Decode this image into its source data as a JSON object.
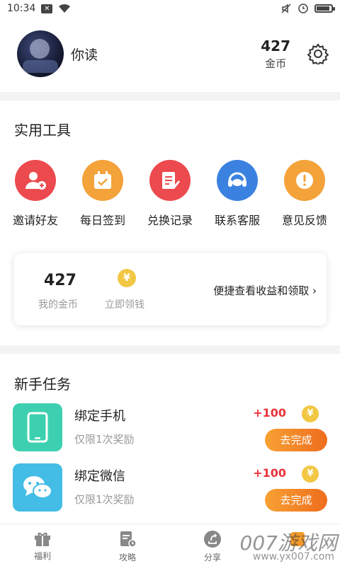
{
  "status_bar": {
    "time": "10:34",
    "x_badge": "✕"
  },
  "profile": {
    "username": "你读",
    "coins": "427",
    "coins_label": "金币"
  },
  "tools": {
    "title": "实用工具",
    "items": [
      {
        "label": "邀请好友",
        "icon": "invite-user-icon",
        "color": "#ec4a4e"
      },
      {
        "label": "每日签到",
        "icon": "calendar-check-icon",
        "color": "#f4a23a"
      },
      {
        "label": "兑换记录",
        "icon": "exchange-record-icon",
        "color": "#ec4a4e"
      },
      {
        "label": "联系客服",
        "icon": "customer-service-icon",
        "color": "#3b82e0"
      },
      {
        "label": "意见反馈",
        "icon": "feedback-icon",
        "color": "#f4a23a"
      }
    ]
  },
  "coin_card": {
    "coins": "427",
    "coins_label": "我的金币",
    "yen_symbol": "¥",
    "claim_label": "立即领钱",
    "link_label": "便捷查看收益和领取"
  },
  "tasks": {
    "title": "新手任务",
    "items": [
      {
        "name": "绑定手机",
        "desc": "仅限1次奖励",
        "reward": "+100",
        "button": "去完成",
        "icon": "phone-icon",
        "color": "#3dd0b0"
      },
      {
        "name": "绑定微信",
        "desc": "仅限1次奖励",
        "reward": "+100",
        "button": "去完成",
        "icon": "wechat-icon",
        "color": "#43bde5"
      }
    ]
  },
  "bottom_nav": {
    "items": [
      {
        "label": "福利",
        "icon": "gift-icon"
      },
      {
        "label": "攻略",
        "icon": "guide-icon"
      },
      {
        "label": "分享",
        "icon": "share-icon"
      },
      {
        "label": "",
        "icon": "profile-icon"
      }
    ]
  },
  "watermark": {
    "brand": "007游戏网",
    "url": "www.yx007.com"
  },
  "colors": {
    "accent_orange": "#ee6d1e",
    "reward_red": "#e8343b",
    "coin_gold": "#f2c744"
  }
}
